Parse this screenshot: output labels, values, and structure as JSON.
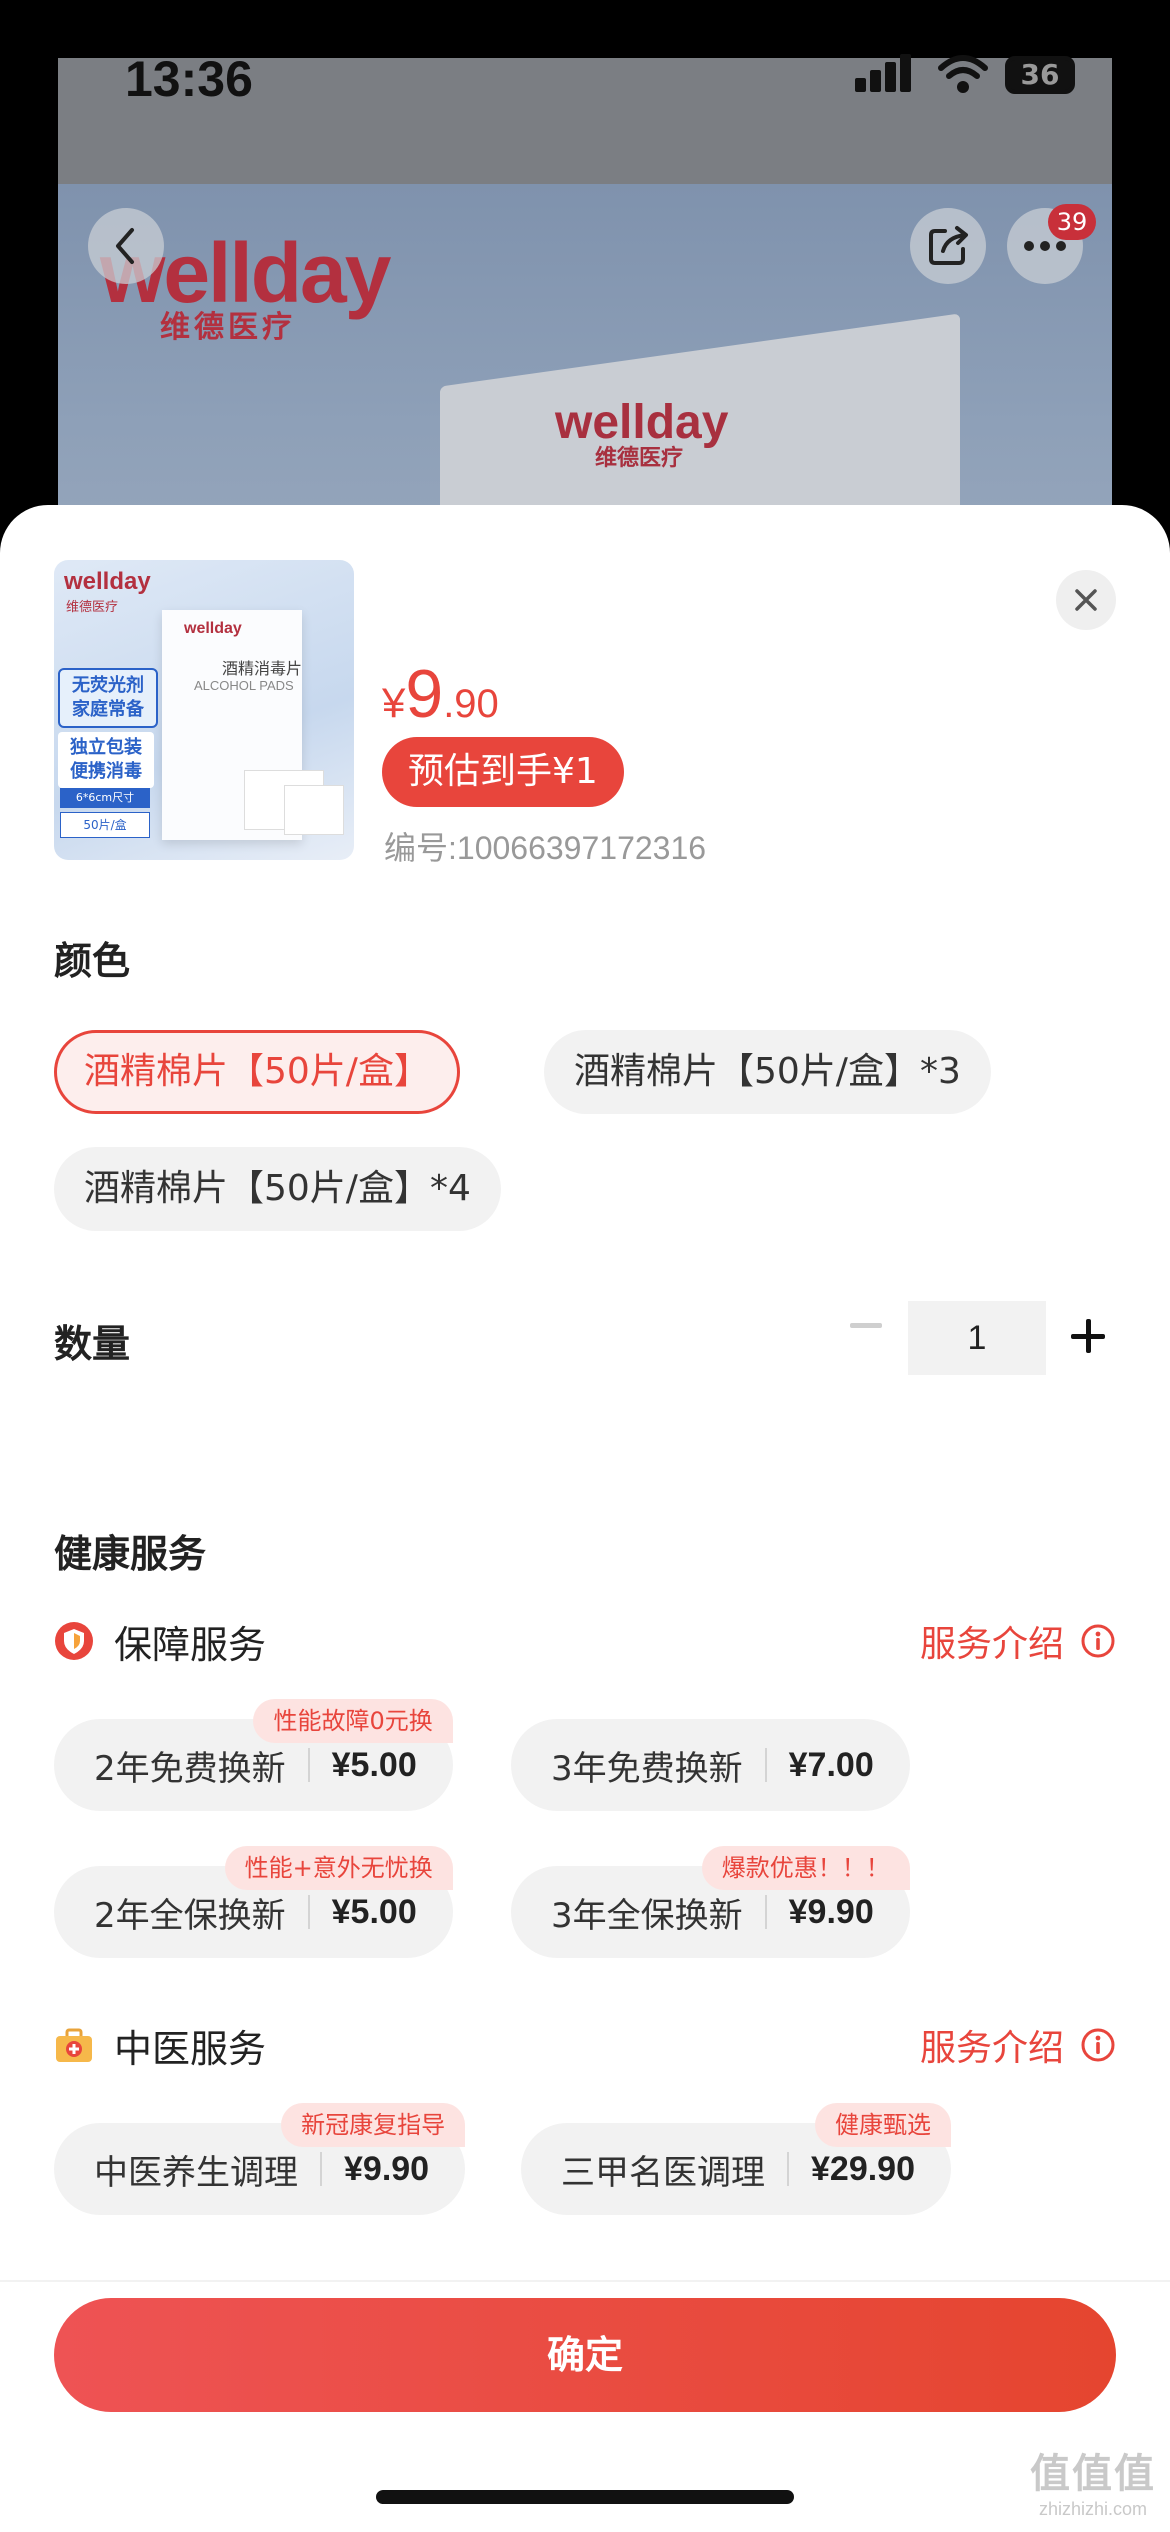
{
  "status_bar": {
    "time": "13:36",
    "battery": "36"
  },
  "background_page": {
    "brand_logo": "wellday",
    "brand_sub": "维德医疗",
    "box_logo": "wellday",
    "box_sub": "维德医疗",
    "more_badge": "39"
  },
  "product": {
    "thumb_brand": "wellday",
    "thumb_brand_sub": "维德医疗",
    "thumb_box_title": "酒精消毒片",
    "thumb_box_en": "ALCOHOL PADS",
    "thumb_tag1": "无荧光剂 家庭常备",
    "thumb_tag2": "独立包装 便携消毒",
    "thumb_size": "6*6cm尺寸",
    "thumb_count": "50片/盒",
    "price_currency": "¥",
    "price_int": "9",
    "price_dec": ".90",
    "estimate_label": "预估到手¥1",
    "sku_code": "编号:10066397172316"
  },
  "color_section": {
    "title": "颜色",
    "options": [
      "酒精棉片【50片/盒】",
      "酒精棉片【50片/盒】*3",
      "酒精棉片【50片/盒】*4"
    ],
    "selected_index": 0
  },
  "quantity": {
    "title": "数量",
    "value": "1"
  },
  "health": {
    "title": "健康服务",
    "protection": {
      "title": "保障服务",
      "intro": "服务介绍",
      "options": [
        {
          "name": "2年免费换新",
          "price": "¥5.00",
          "tag": "性能故障0元换"
        },
        {
          "name": "3年免费换新",
          "price": "¥7.00",
          "tag": ""
        },
        {
          "name": "2年全保换新",
          "price": "¥5.00",
          "tag": "性能+意外无忧换"
        },
        {
          "name": "3年全保换新",
          "price": "¥9.90",
          "tag": "爆款优惠！！！"
        }
      ]
    },
    "tcm": {
      "title": "中医服务",
      "intro": "服务介绍",
      "options": [
        {
          "name": "中医养生调理",
          "price": "¥9.90",
          "tag": "新冠康复指导"
        },
        {
          "name": "三甲名医调理",
          "price": "¥29.90",
          "tag": "健康甄选"
        }
      ]
    }
  },
  "footer": {
    "confirm_label": "确定"
  },
  "watermark": {
    "main": "值值值",
    "sub": "zhizhizhi.com"
  },
  "colors": {
    "accent": "#e8453c",
    "chip_bg": "#f2f2f2",
    "tag_bg": "#fde3e1"
  },
  "icons": {
    "back": "chevron-left-icon",
    "share": "share-icon",
    "more": "more-icon",
    "close": "close-icon",
    "shield": "shield-icon",
    "medkit": "medkit-icon",
    "info": "info-icon",
    "minus": "minus-icon",
    "plus": "plus-icon"
  }
}
